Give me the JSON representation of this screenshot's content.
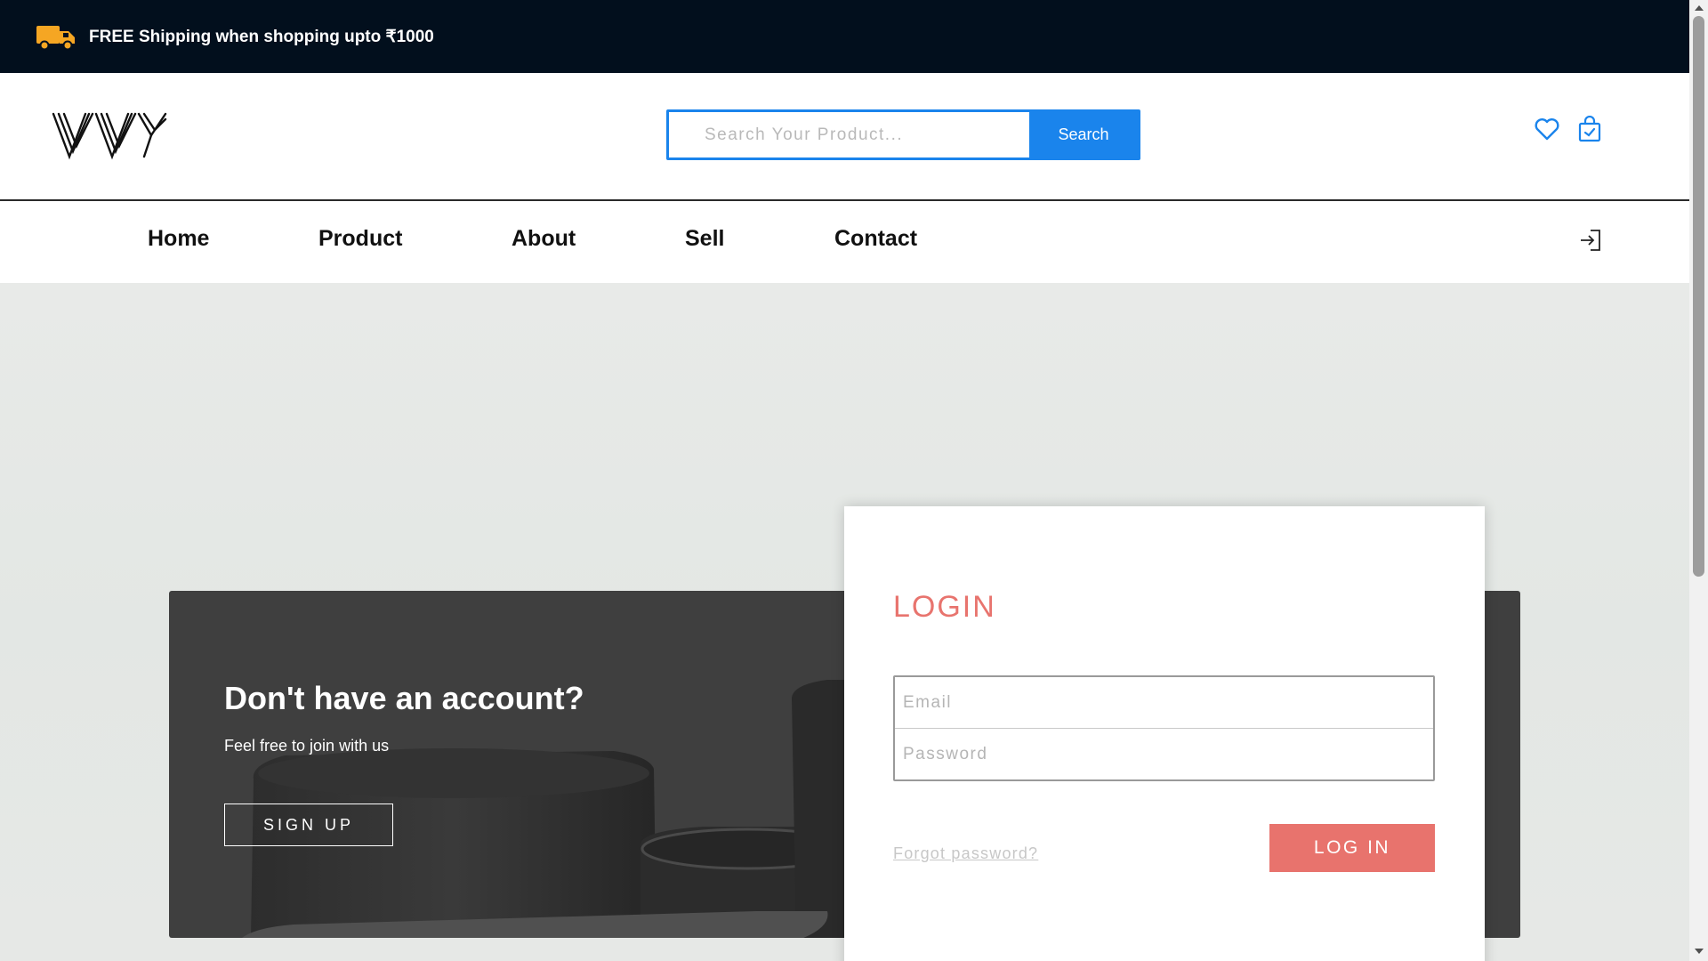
{
  "promo": {
    "text": "FREE Shipping when shopping upto ₹1000",
    "icon": "truck-icon",
    "icon_color": "#f5a623",
    "background": "#020f1d"
  },
  "header": {
    "logo": "VY",
    "search": {
      "placeholder": "Search Your Product...",
      "value": "",
      "button_label": "Search"
    },
    "icons": [
      "heart-icon",
      "shopping-bag-icon"
    ],
    "accent_color": "#1a84ec"
  },
  "nav": {
    "items": [
      {
        "label": "Home"
      },
      {
        "label": "Product"
      },
      {
        "label": "About"
      },
      {
        "label": "Sell"
      },
      {
        "label": "Contact"
      }
    ],
    "right_icon": "sign-in-icon"
  },
  "signup_panel": {
    "title": "Don't have an account?",
    "subtitle": "Feel free to join with us",
    "button_label": "SIGN UP"
  },
  "login_card": {
    "title": "LOGIN",
    "email_placeholder": "Email",
    "email_value": "",
    "password_placeholder": "Password",
    "password_value": "",
    "forgot_label": "Forgot password?",
    "button_label": "LOG IN",
    "accent_color": "#e8736d"
  }
}
